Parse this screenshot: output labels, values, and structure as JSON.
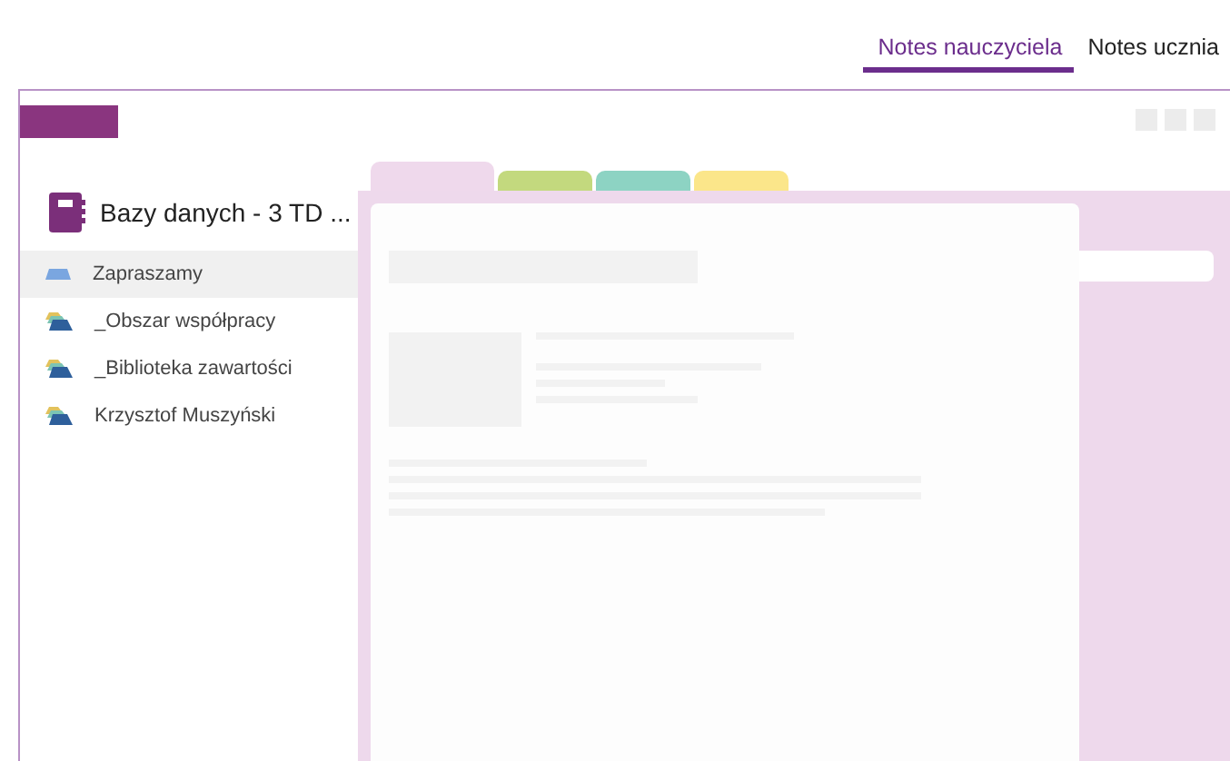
{
  "tabs": [
    {
      "label": "Notes nauczyciela",
      "selected": true
    },
    {
      "label": "Notes ucznia",
      "selected": false
    }
  ],
  "notebook": {
    "title": "Bazy danych - 3 TD ..."
  },
  "sections": [
    {
      "label": "Zapraszamy",
      "kind": "section",
      "selected": true
    },
    {
      "label": "_Obszar współpracy",
      "kind": "group",
      "selected": false
    },
    {
      "label": "_Biblioteka zawartości",
      "kind": "group",
      "selected": false
    },
    {
      "label": "Krzysztof Muszyński",
      "kind": "group",
      "selected": false
    }
  ],
  "section_tabs": [
    {
      "color": "#efd9ec"
    },
    {
      "color": "#c3d97e"
    },
    {
      "color": "#8dd3c3"
    },
    {
      "color": "#fbe68a"
    }
  ]
}
